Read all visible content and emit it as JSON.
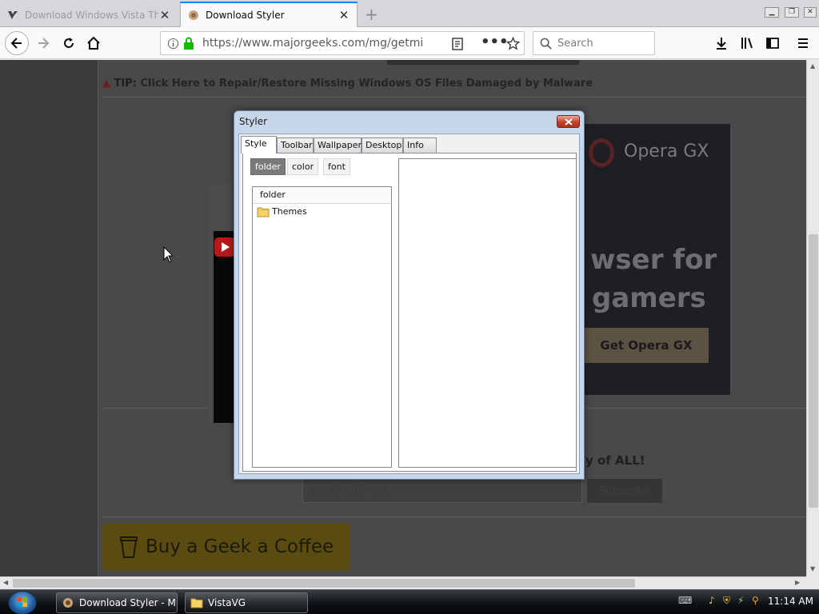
{
  "browser": {
    "tabs": [
      {
        "title": "Download Windows Vista The...",
        "active": false
      },
      {
        "title": "Download Styler",
        "active": true
      }
    ],
    "url": "https://www.majorgeeks.com/mg/getmirror/",
    "search_placeholder": "Search"
  },
  "page": {
    "tip_label": "TIP:",
    "tip_link": "Click Here to Repair/Restore Missing Windows OS Files Damaged by Malware",
    "ad": {
      "brand": "Opera GX",
      "headline_1": "wser for",
      "headline_2": "gamers",
      "cta": "Get Opera GX"
    },
    "newsletter_text": "y of ALL!",
    "email_placeholder": "email address",
    "subscribe_label": "Subscribe",
    "coffee_label": "Buy a Geek a Coffee"
  },
  "dialog": {
    "title": "Styler",
    "tabs": [
      "Style",
      "Toolbar",
      "Wallpaper",
      "Desktop",
      "Info"
    ],
    "active_tab": "Style",
    "subtabs": [
      "folder",
      "color",
      "font"
    ],
    "selected_subtab": "folder",
    "list_header": "folder",
    "list_items": [
      "Themes"
    ]
  },
  "taskbar": {
    "items": [
      {
        "label": "Download Styler - M...",
        "icon": "firefox-icon"
      },
      {
        "label": "VistaVG",
        "icon": "folder-icon"
      }
    ],
    "clock": "11:14 AM"
  }
}
